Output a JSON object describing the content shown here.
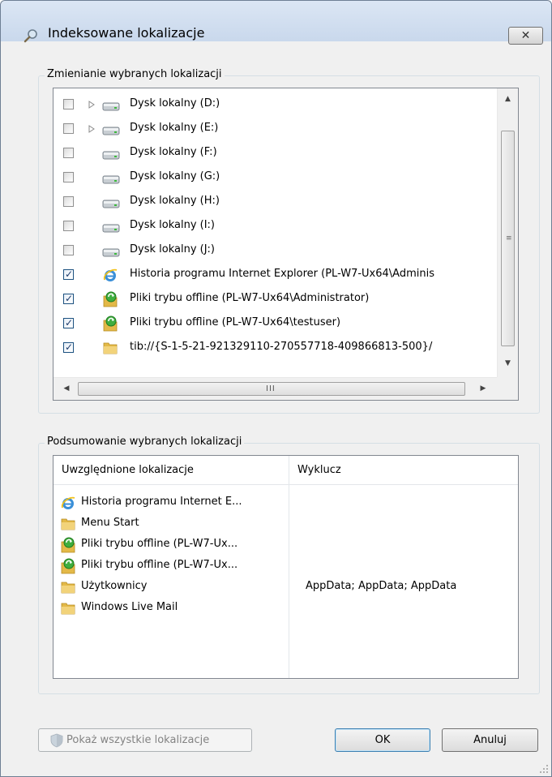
{
  "window": {
    "title": "Indeksowane lokalizacje",
    "close_glyph": "✕"
  },
  "change_group": {
    "label": "Zmienianie wybranych lokalizacji",
    "items": [
      {
        "label": "Dysk lokalny (D:)",
        "checked": false,
        "expandable": true,
        "icon": "drive-icon"
      },
      {
        "label": "Dysk lokalny (E:)",
        "checked": false,
        "expandable": true,
        "icon": "drive-icon"
      },
      {
        "label": "Dysk lokalny (F:)",
        "checked": false,
        "expandable": false,
        "icon": "drive-icon"
      },
      {
        "label": "Dysk lokalny (G:)",
        "checked": false,
        "expandable": false,
        "icon": "drive-icon"
      },
      {
        "label": "Dysk lokalny (H:)",
        "checked": false,
        "expandable": false,
        "icon": "drive-icon"
      },
      {
        "label": "Dysk lokalny (I:)",
        "checked": false,
        "expandable": false,
        "icon": "drive-icon"
      },
      {
        "label": "Dysk lokalny (J:)",
        "checked": false,
        "expandable": false,
        "icon": "drive-icon"
      },
      {
        "label": "Historia programu Internet Explorer (PL-W7-Ux64\\Adminis",
        "checked": true,
        "expandable": false,
        "icon": "internet-explorer-icon"
      },
      {
        "label": "Pliki trybu offline (PL-W7-Ux64\\Administrator)",
        "checked": true,
        "expandable": false,
        "icon": "offline-files-icon"
      },
      {
        "label": "Pliki trybu offline (PL-W7-Ux64\\testuser)",
        "checked": true,
        "expandable": false,
        "icon": "offline-files-icon"
      },
      {
        "label": "tib://{S-1-5-21-921329110-270557718-409866813-500}/",
        "checked": true,
        "expandable": false,
        "icon": "folder-icon"
      }
    ],
    "hscroll_grip": "III"
  },
  "summary_group": {
    "label": "Podsumowanie wybranych lokalizacji",
    "col_included": "Uwzględnione lokalizacje",
    "col_exclude": "Wyklucz",
    "rows": [
      {
        "included": "Historia programu Internet E...",
        "exclude": "",
        "icon": "internet-explorer-icon"
      },
      {
        "included": "Menu Start",
        "exclude": "",
        "icon": "folder-icon"
      },
      {
        "included": "Pliki trybu offline (PL-W7-Ux...",
        "exclude": "",
        "icon": "offline-files-icon"
      },
      {
        "included": "Pliki trybu offline (PL-W7-Ux...",
        "exclude": "",
        "icon": "offline-files-icon"
      },
      {
        "included": "Użytkownicy",
        "exclude": "AppData; AppData; AppData",
        "icon": "folder-icon"
      },
      {
        "included": "Windows Live Mail",
        "exclude": "",
        "icon": "folder-icon"
      }
    ]
  },
  "buttons": {
    "show_all": "Pokaż wszystkie lokalizacje",
    "ok": "OK",
    "cancel": "Anuluj"
  },
  "colors": {
    "accent": "#3c7fb1",
    "folder": "#e8c45a",
    "checkbox_border": "#1c5180"
  }
}
